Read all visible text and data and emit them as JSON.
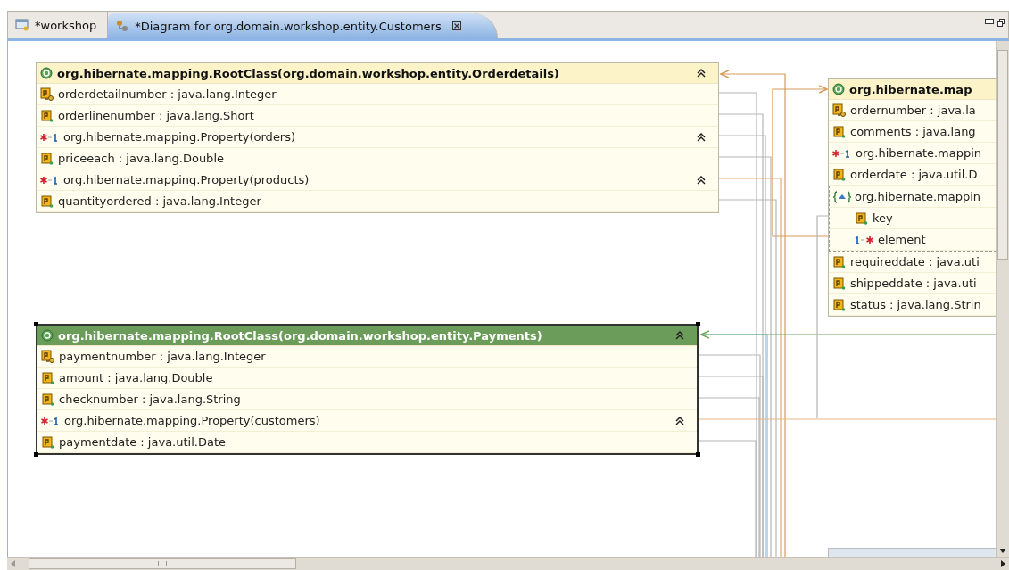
{
  "tabs": [
    {
      "label": "*workshop",
      "selected": false,
      "kind": "model"
    },
    {
      "label": "*Diagram for org.domain.workshop.entity.Customers",
      "selected": true,
      "kind": "diagram",
      "closable": true
    }
  ],
  "entities": [
    {
      "title": "org.hibernate.mapping.RootClass(org.domain.workshop.entity.Orderdetails)",
      "selected": false,
      "collapsible": true,
      "rows": [
        {
          "kind": "id",
          "text": "orderdetailnumber : java.lang.Integer"
        },
        {
          "kind": "property",
          "text": "orderlinenumber : java.lang.Short"
        },
        {
          "kind": "many-to-one",
          "text": "org.hibernate.mapping.Property(orders)",
          "collapsible": true
        },
        {
          "kind": "property",
          "text": "priceeach : java.lang.Double"
        },
        {
          "kind": "many-to-one",
          "text": "org.hibernate.mapping.Property(products)",
          "collapsible": true
        },
        {
          "kind": "property",
          "text": "quantityordered : java.lang.Integer"
        }
      ]
    },
    {
      "title": "org.hibernate.map",
      "selected": false,
      "rows": [
        {
          "kind": "id",
          "text": "ordernumber : java.la"
        },
        {
          "kind": "property",
          "text": "comments : java.lang"
        },
        {
          "kind": "many-to-one",
          "text": "org.hibernate.mappin"
        },
        {
          "kind": "property",
          "text": "orderdate : java.util.D"
        },
        {
          "kind": "component",
          "text": "org.hibernate.mappin",
          "children": [
            {
              "kind": "property",
              "text": "key"
            },
            {
              "kind": "one-to-many",
              "text": "element"
            }
          ]
        },
        {
          "kind": "property",
          "text": "requireddate : java.uti"
        },
        {
          "kind": "property",
          "text": "shippeddate : java.uti"
        },
        {
          "kind": "property",
          "text": "status : java.lang.Strin"
        }
      ]
    },
    {
      "title": "org.hibernate.mapping.RootClass(org.domain.workshop.entity.Payments)",
      "selected": true,
      "collapsible": true,
      "rows": [
        {
          "kind": "id",
          "text": "paymentnumber : java.lang.Integer"
        },
        {
          "kind": "property",
          "text": "amount : java.lang.Double"
        },
        {
          "kind": "property",
          "text": "checknumber : java.lang.String"
        },
        {
          "kind": "many-to-one",
          "text": "org.hibernate.mapping.Property(customers)",
          "collapsible": true
        },
        {
          "kind": "property",
          "text": "paymentdate : java.util.Date"
        }
      ]
    }
  ]
}
